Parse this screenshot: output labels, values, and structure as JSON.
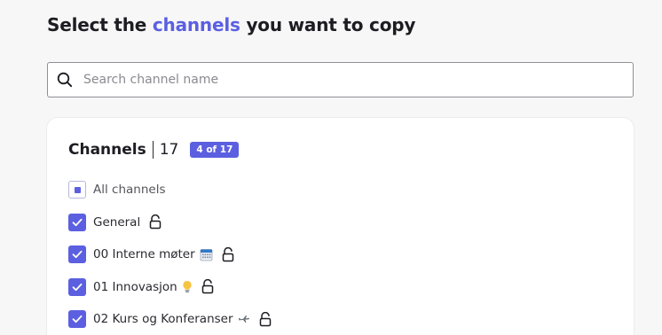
{
  "header": {
    "title_before": "Select the",
    "title_accent": "channels",
    "title_after": "you want to copy"
  },
  "search": {
    "placeholder": "Search channel name",
    "value": ""
  },
  "channels_panel": {
    "heading": "Channels",
    "total": "17",
    "selected_badge": "4 of 17",
    "all_label": "All channels",
    "all_state": "partial",
    "items": [
      {
        "label": "General",
        "checked": true,
        "emoji": "",
        "icon": "unlock-icon"
      },
      {
        "label": "00 Interne møter",
        "checked": true,
        "emoji": "calendar-icon",
        "icon": "unlock-icon"
      },
      {
        "label": "01 Innovasjon",
        "checked": true,
        "emoji": "lightbulb-icon",
        "icon": "unlock-icon"
      },
      {
        "label": "02 Kurs og Konferanser",
        "checked": true,
        "emoji": "airplane-icon",
        "icon": "unlock-icon"
      }
    ]
  },
  "colors": {
    "accent": "#5b5fe0",
    "background": "#f7f7f8",
    "card": "#ffffff"
  }
}
